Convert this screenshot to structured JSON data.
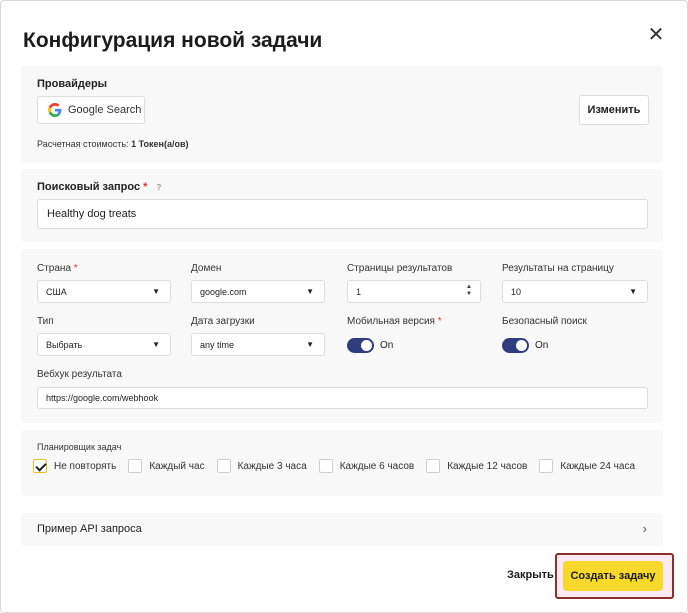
{
  "dialog": {
    "title": "Конфигурация новой задачи",
    "close_icon": "close-icon"
  },
  "providers": {
    "label": "Провайдеры",
    "selected": "Google Search",
    "change_label": "Изменить",
    "cost_prefix": "Расчетная стоимость:",
    "cost_value": "1 Токен(а/ов)"
  },
  "query": {
    "label": "Поисковый запрос",
    "required_mark": "*",
    "help_mark": "?",
    "value": "Healthy dog treats"
  },
  "settings": {
    "country": {
      "label": "Страна",
      "required_mark": "*",
      "value": "США"
    },
    "domain": {
      "label": "Домен",
      "value": "google.com"
    },
    "pages": {
      "label": "Страницы результатов",
      "value": "1"
    },
    "per_page": {
      "label": "Результаты на страницу",
      "value": "10"
    },
    "type": {
      "label": "Тип",
      "value": "Выбрать"
    },
    "date": {
      "label": "Дата загрузки",
      "value": "any time"
    },
    "mobile": {
      "label": "Мобильная версия",
      "required_mark": "*",
      "state": "On"
    },
    "safe_search": {
      "label": "Безопасный поиск",
      "state": "On"
    },
    "webhook": {
      "label": "Вебхук результата",
      "value": "https://google.com/webhook"
    }
  },
  "scheduler": {
    "label": "Планировщик задач",
    "options": [
      {
        "label": "Не повторять",
        "checked": true
      },
      {
        "label": "Каждый час",
        "checked": false
      },
      {
        "label": "Каждые 3 часа",
        "checked": false
      },
      {
        "label": "Каждые 6 часов",
        "checked": false
      },
      {
        "label": "Каждые 12 часов",
        "checked": false
      },
      {
        "label": "Каждые 24 часа",
        "checked": false
      }
    ]
  },
  "api_example": {
    "label": "Пример API запроса"
  },
  "footer": {
    "close_label": "Закрыть",
    "create_label": "Создать задачу"
  },
  "colors": {
    "accent": "#f8d82a",
    "toggle": "#2f3c7e",
    "highlight_border": "#8b2e2e",
    "required": "#e0312e"
  }
}
